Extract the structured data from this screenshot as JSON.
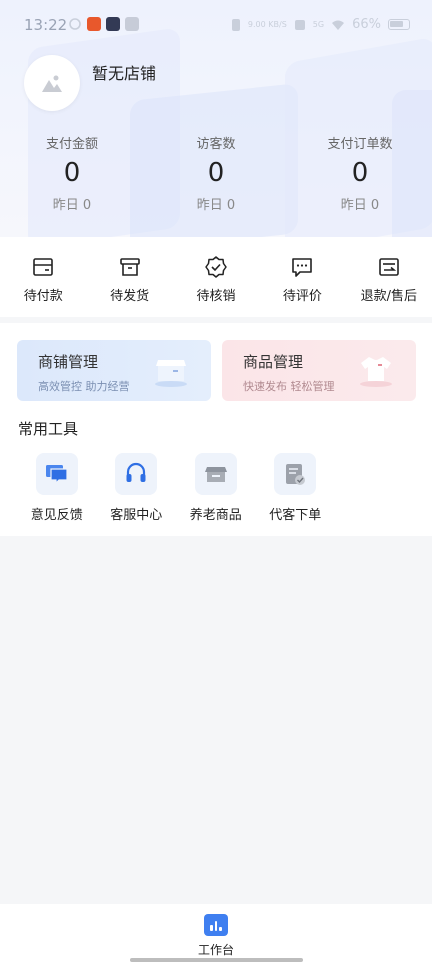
{
  "status_bar": {
    "time": "13:22",
    "signal": "5G",
    "speed": "9.00 KB/S",
    "battery": "66%",
    "icon_colors": [
      "#e8582c",
      "#333a55",
      "#c7ccd8"
    ]
  },
  "store": {
    "name": "暂无店铺",
    "avatar_icon": "image-placeholder-icon"
  },
  "stats": [
    {
      "label": "支付金额",
      "value": "0",
      "yesterday": "昨日 0"
    },
    {
      "label": "访客数",
      "value": "0",
      "yesterday": "昨日 0"
    },
    {
      "label": "支付订单数",
      "value": "0",
      "yesterday": "昨日 0"
    }
  ],
  "orders": [
    {
      "label": "待付款",
      "icon": "wallet-icon"
    },
    {
      "label": "待发货",
      "icon": "box-icon"
    },
    {
      "label": "待核销",
      "icon": "verify-badge-icon"
    },
    {
      "label": "待评价",
      "icon": "comment-icon"
    },
    {
      "label": "退款/售后",
      "icon": "refund-icon"
    }
  ],
  "cards": {
    "shop": {
      "title": "商铺管理",
      "subtitle": "高效管控 助力经营",
      "icon": "storefront-icon",
      "color": "#dce8fb"
    },
    "goods": {
      "title": "商品管理",
      "subtitle": "快速发布 轻松管理",
      "icon": "tshirt-icon",
      "color": "#fbe5e8"
    }
  },
  "tools": {
    "title": "常用工具",
    "items": [
      {
        "label": "意见反馈",
        "icon": "feedback-chat-icon"
      },
      {
        "label": "客服中心",
        "icon": "headset-icon"
      },
      {
        "label": "养老商品",
        "icon": "store-awning-icon"
      },
      {
        "label": "代客下单",
        "icon": "order-form-icon"
      }
    ]
  },
  "tabbar": {
    "active": {
      "label": "工作台",
      "icon": "bar-chart-icon"
    },
    "accent": "#3f7ff0"
  }
}
